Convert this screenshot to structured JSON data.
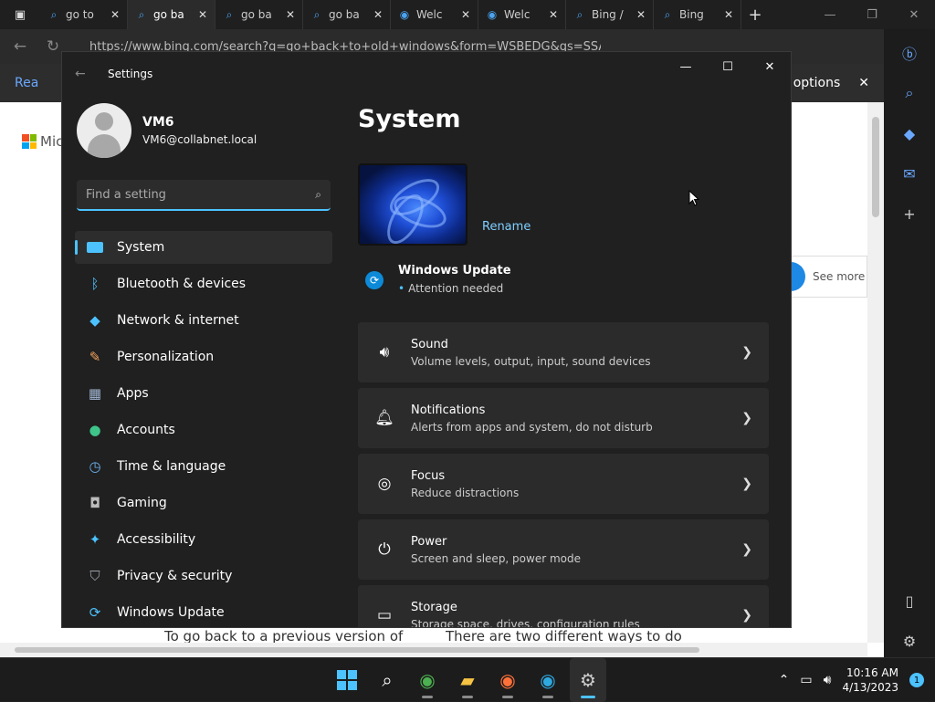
{
  "browser": {
    "tabs": [
      {
        "label": "go to",
        "icon": "search-icon",
        "active": false
      },
      {
        "label": "go ba",
        "icon": "search-icon",
        "active": true
      },
      {
        "label": "go ba",
        "icon": "search-icon",
        "active": false
      },
      {
        "label": "go ba",
        "icon": "search-icon",
        "active": false
      },
      {
        "label": "Welc",
        "icon": "edge-icon",
        "active": false
      },
      {
        "label": "Welc",
        "icon": "edge-icon",
        "active": false
      },
      {
        "label": "Bing /",
        "icon": "search-icon",
        "active": false
      },
      {
        "label": "Bing",
        "icon": "search-icon",
        "active": false
      }
    ],
    "url": "https://www.bing.com/search?q=go+back+to+old+windows&form=WSBEDG&qs=SSA...",
    "infobar_left": "Rea",
    "infobar_right": "options",
    "page_logo_text": "Mic",
    "see_more": "See more",
    "bottom_text_1": "To go back to a previous version of",
    "bottom_text_2": "There are two different ways to do"
  },
  "settings": {
    "window_title": "Settings",
    "user": {
      "name": "VM6",
      "email": "VM6@collabnet.local"
    },
    "search_placeholder": "Find a setting",
    "nav": [
      {
        "label": "System",
        "icon": "system-icon",
        "active": true
      },
      {
        "label": "Bluetooth & devices",
        "icon": "bluetooth-icon"
      },
      {
        "label": "Network & internet",
        "icon": "wifi-icon"
      },
      {
        "label": "Personalization",
        "icon": "brush-icon"
      },
      {
        "label": "Apps",
        "icon": "apps-icon"
      },
      {
        "label": "Accounts",
        "icon": "account-icon"
      },
      {
        "label": "Time & language",
        "icon": "clock-globe-icon"
      },
      {
        "label": "Gaming",
        "icon": "gamepad-icon"
      },
      {
        "label": "Accessibility",
        "icon": "accessibility-icon"
      },
      {
        "label": "Privacy & security",
        "icon": "shield-icon"
      },
      {
        "label": "Windows Update",
        "icon": "update-icon"
      }
    ],
    "page_title": "System",
    "rename": "Rename",
    "windows_update": {
      "title": "Windows Update",
      "status": "Attention needed"
    },
    "cards": [
      {
        "title": "Sound",
        "desc": "Volume levels, output, input, sound devices",
        "icon": "speaker-icon"
      },
      {
        "title": "Notifications",
        "desc": "Alerts from apps and system, do not disturb",
        "icon": "bell-icon"
      },
      {
        "title": "Focus",
        "desc": "Reduce distractions",
        "icon": "focus-icon"
      },
      {
        "title": "Power",
        "desc": "Screen and sleep, power mode",
        "icon": "power-icon"
      },
      {
        "title": "Storage",
        "desc": "Storage space, drives, configuration rules",
        "icon": "storage-icon"
      }
    ]
  },
  "taskbar": {
    "time": "10:16 AM",
    "date": "4/13/2023",
    "notification_count": "1"
  },
  "colors": {
    "accent": "#4cc2ff",
    "link": "#7fcfff",
    "card_bg": "#2b2b2b",
    "window_bg": "#202020"
  }
}
